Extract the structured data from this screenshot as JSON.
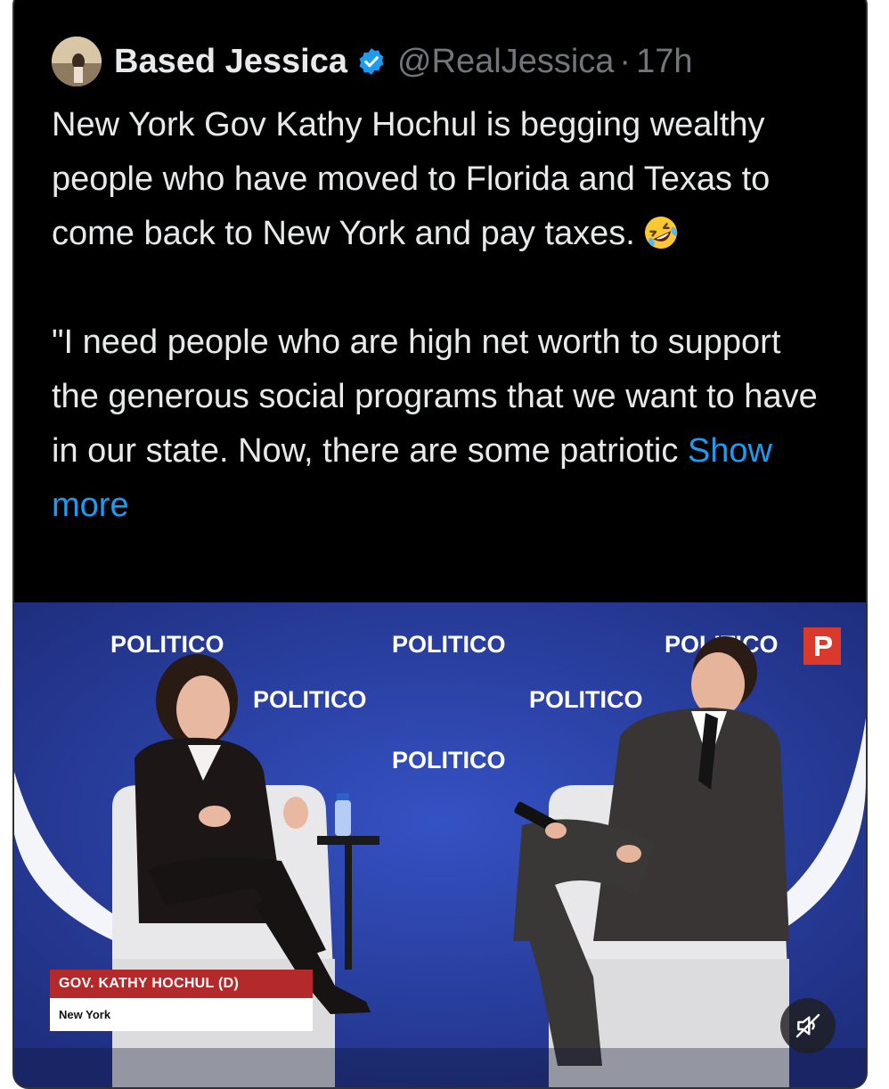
{
  "author": {
    "display_name": "Based Jessica",
    "handle": "@RealJessica",
    "separator": "·",
    "time": "17h",
    "verified": true
  },
  "tweet": {
    "paragraph1": "New York Gov Kathy Hochul is begging wealthy people who have moved to Florida and Texas to come back to New York and pay taxes.",
    "emoji": "rolling-on-floor-laughing-emoji",
    "paragraph2": "\"I need people who are  high net worth to support the generous social programs that we want to have in our state. Now, there are some patriotic",
    "show_more": "Show more"
  },
  "media": {
    "backdrop_logos": [
      "POLITICO",
      "POLITICO",
      "POLITICO",
      "POLITICO",
      "POLITICO",
      "POLITICO"
    ],
    "lower_third": {
      "title": "GOV. KATHY HOCHUL (D)",
      "subtitle": "New York"
    },
    "mute_icon": "speaker-muted-icon"
  },
  "colors": {
    "background": "#000000",
    "text": "#e7e9ea",
    "muted": "#71767b",
    "link": "#1d9bf0",
    "verified": "#1d9bf0",
    "stage_blue": "#2a3f9c",
    "lower_third_red": "#b42a2a"
  }
}
